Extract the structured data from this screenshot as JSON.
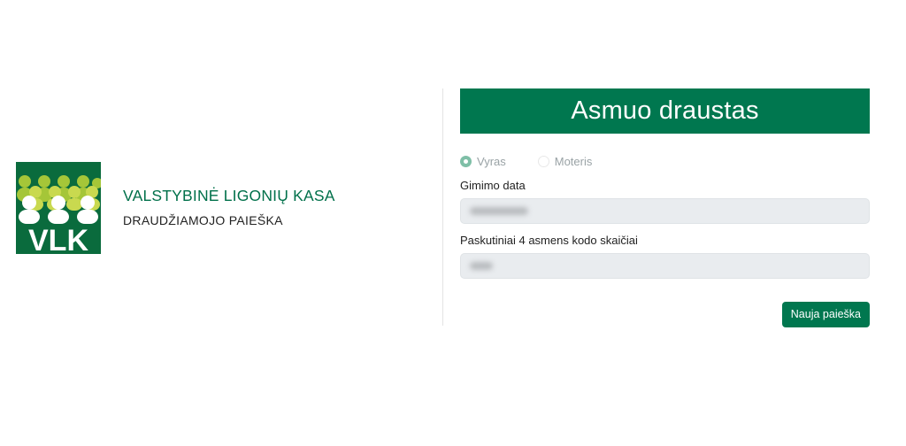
{
  "brand": {
    "logo_text": "VLK",
    "org_name": "VALSTYBINĖ LIGONIŲ KASA",
    "subtitle": "DRAUDŽIAMOJO PAIEŠKA"
  },
  "panel": {
    "banner": "Asmuo draustas",
    "gender_options": [
      {
        "label": "Vyras",
        "selected": true
      },
      {
        "label": "Moteris",
        "selected": false
      }
    ],
    "birth_date_label": "Gimimo data",
    "birth_date_value": "",
    "personal_code_label": "Paskutiniai 4 asmens kodo skaičiai",
    "personal_code_value": "",
    "new_search_label": "Nauja paieška"
  },
  "colors": {
    "primary": "#00774f",
    "brand_text": "#00704a",
    "logo_light_green": "#a5c638",
    "logo_dark_green": "#0a6b3d",
    "field_bg": "#e9ecef"
  }
}
